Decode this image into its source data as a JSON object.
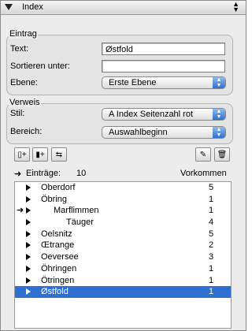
{
  "palette": {
    "title": "Index"
  },
  "entry": {
    "group_label": "Eintrag",
    "text_label": "Text:",
    "text_value": "Østfold",
    "sort_label": "Sortieren unter:",
    "sort_value": "",
    "level_label": "Ebene:",
    "level_value": "Erste Ebene"
  },
  "reference": {
    "group_label": "Verweis",
    "style_label": "Stil:",
    "style_value": "A Index Seitenzahl rot",
    "range_label": "Bereich:",
    "range_value": "Auswahlbeginn"
  },
  "list_header": {
    "entries_label": "Einträge:",
    "entries_count": "10",
    "occurrences_label": "Vorkommen"
  },
  "entries": [
    {
      "name": "Oberdorf",
      "count": "5",
      "indent": 0,
      "pointer": false,
      "selected": false
    },
    {
      "name": "Öbring",
      "count": "1",
      "indent": 0,
      "pointer": false,
      "selected": false
    },
    {
      "name": "Marflimmen",
      "count": "1",
      "indent": 1,
      "pointer": true,
      "selected": false
    },
    {
      "name": "Täuger",
      "count": "4",
      "indent": 2,
      "pointer": false,
      "selected": false
    },
    {
      "name": "Oelsnitz",
      "count": "5",
      "indent": 0,
      "pointer": false,
      "selected": false
    },
    {
      "name": "Œtrange",
      "count": "2",
      "indent": 0,
      "pointer": false,
      "selected": false
    },
    {
      "name": "Oeversee",
      "count": "3",
      "indent": 0,
      "pointer": false,
      "selected": false
    },
    {
      "name": "Öhringen",
      "count": "1",
      "indent": 0,
      "pointer": false,
      "selected": false
    },
    {
      "name": "Ötringen",
      "count": "1",
      "indent": 0,
      "pointer": false,
      "selected": false
    },
    {
      "name": "Østfold",
      "count": "1",
      "indent": 0,
      "pointer": false,
      "selected": true
    }
  ]
}
